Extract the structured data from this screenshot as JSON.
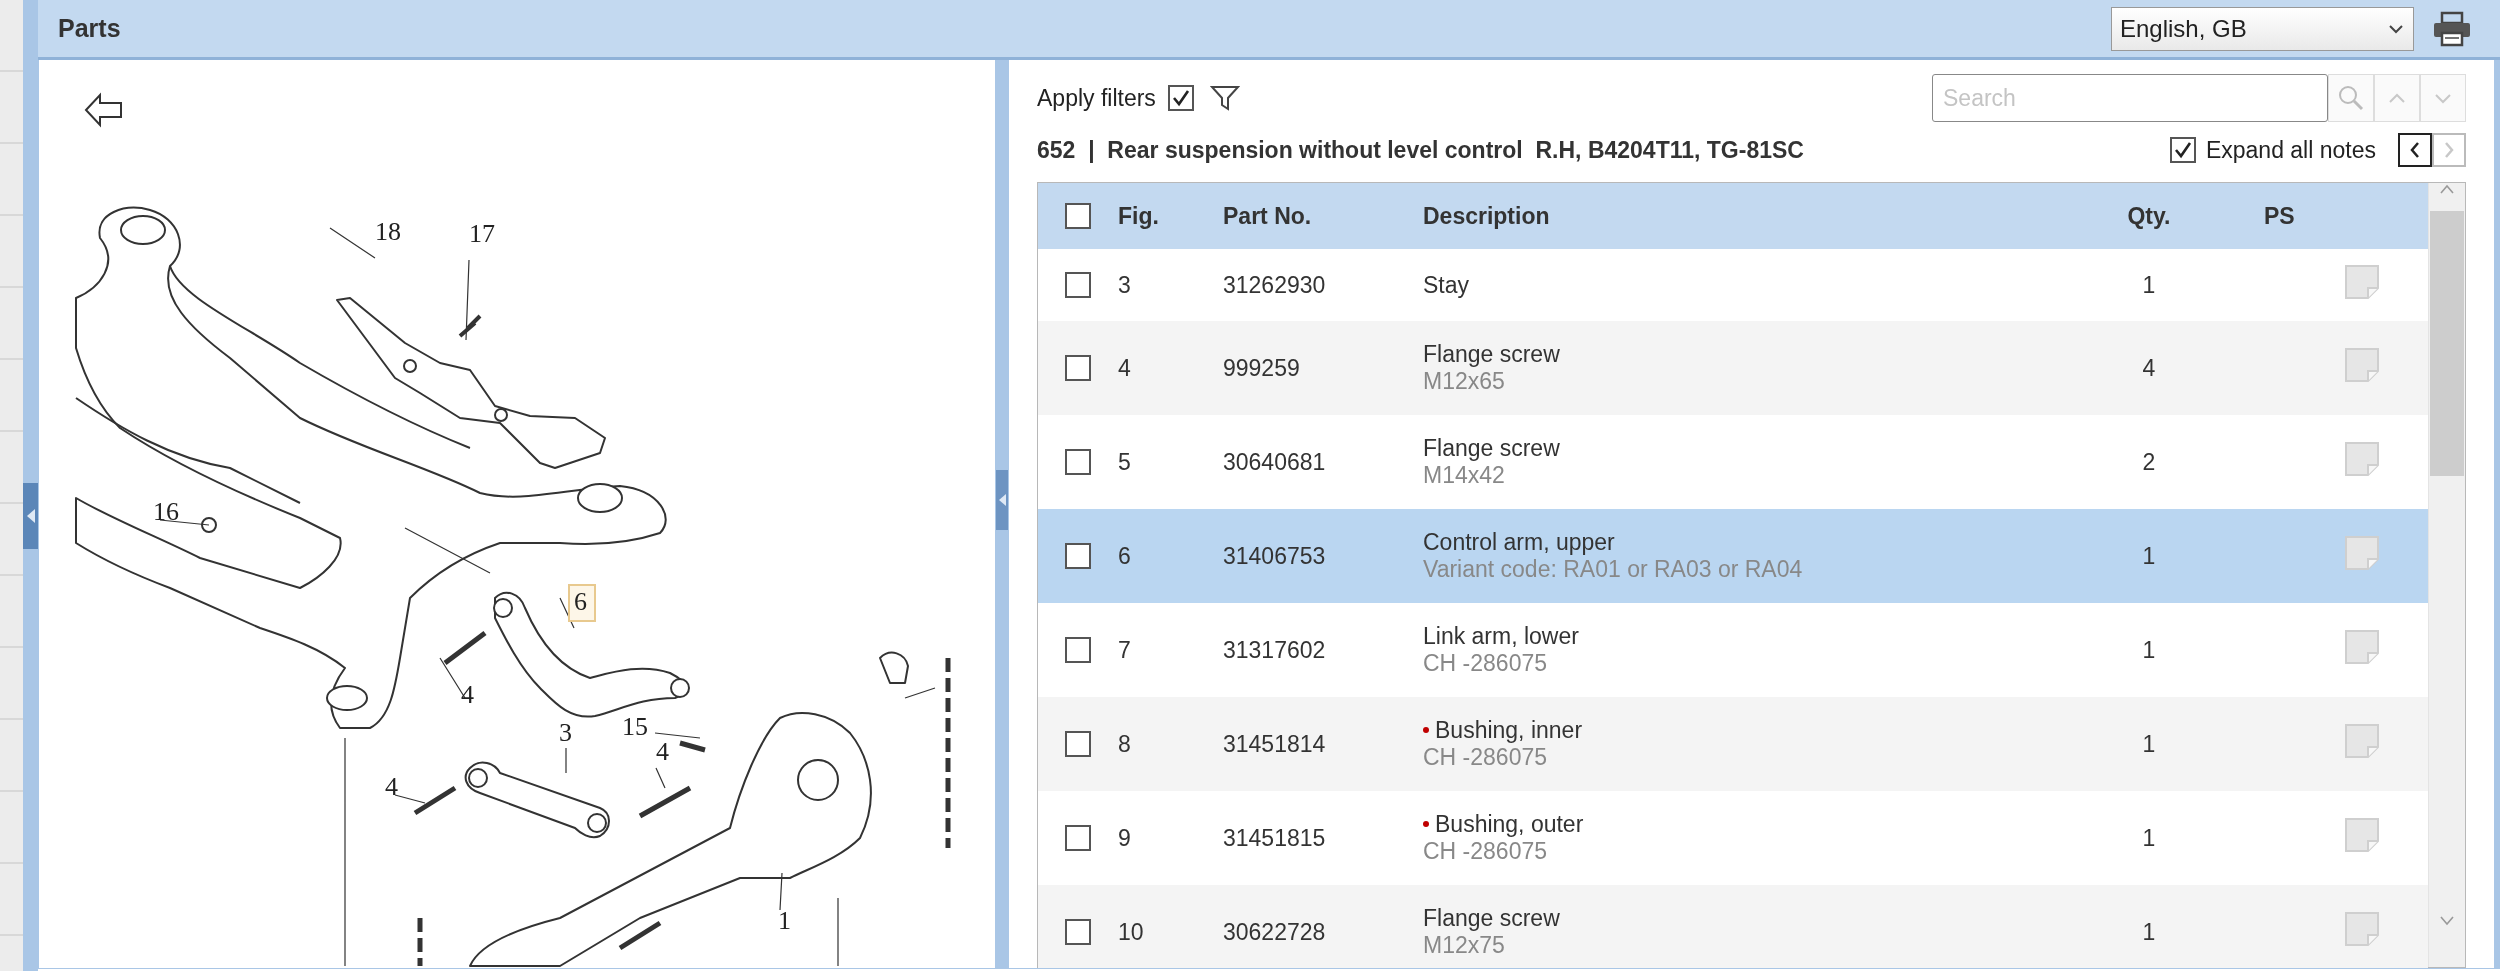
{
  "header": {
    "title": "Parts",
    "language": "English, GB"
  },
  "diagram": {
    "callouts": [
      {
        "label": "18",
        "selected": false
      },
      {
        "label": "17",
        "selected": false
      },
      {
        "label": "16",
        "selected": false
      },
      {
        "label": "6",
        "selected": true
      },
      {
        "label": "4",
        "selected": false
      },
      {
        "label": "3",
        "selected": false
      },
      {
        "label": "15",
        "selected": false
      },
      {
        "label": "4",
        "selected": false
      },
      {
        "label": "4",
        "selected": false
      },
      {
        "label": "1",
        "selected": false
      }
    ]
  },
  "filters": {
    "label": "Apply filters",
    "checked": true
  },
  "search": {
    "placeholder": "Search",
    "nav_buttons": [
      {
        "kind": "up",
        "disabled": true
      },
      {
        "kind": "down",
        "disabled": true
      }
    ]
  },
  "group_title": "652  |  Rear suspension without level control  R.H, B4204T11, TG-81SC",
  "expand_notes": {
    "label": "Expand all notes",
    "checked": true
  },
  "pager": [
    {
      "kind": "previous",
      "disabled": false
    },
    {
      "kind": "next",
      "disabled": true
    }
  ],
  "table": {
    "columns": [
      "Fig.",
      "Part No.",
      "Description",
      "Qty.",
      "PS"
    ],
    "all_checked": false,
    "rows": [
      {
        "fig": "3",
        "part_no": "31262930",
        "description": "Stay",
        "note": "",
        "qty": "1",
        "checked": false,
        "selected": false,
        "flagged": false
      },
      {
        "fig": "4",
        "part_no": "999259",
        "description": "Flange screw",
        "note": "M12x65",
        "qty": "4",
        "checked": false,
        "selected": false,
        "flagged": false
      },
      {
        "fig": "5",
        "part_no": "30640681",
        "description": "Flange screw",
        "note": "M14x42",
        "qty": "2",
        "checked": false,
        "selected": false,
        "flagged": false
      },
      {
        "fig": "6",
        "part_no": "31406753",
        "description": "Control arm, upper",
        "note": "Variant code: RA01 or RA03 or RA04",
        "qty": "1",
        "checked": false,
        "selected": true,
        "flagged": false
      },
      {
        "fig": "7",
        "part_no": "31317602",
        "description": "Link arm, lower",
        "note": "CH -286075",
        "qty": "1",
        "checked": false,
        "selected": false,
        "flagged": false
      },
      {
        "fig": "8",
        "part_no": "31451814",
        "description": "Bushing, inner",
        "note": "CH -286075",
        "qty": "1",
        "checked": false,
        "selected": false,
        "flagged": true
      },
      {
        "fig": "9",
        "part_no": "31451815",
        "description": "Bushing, outer",
        "note": "CH -286075",
        "qty": "1",
        "checked": false,
        "selected": false,
        "flagged": true
      },
      {
        "fig": "10",
        "part_no": "30622728",
        "description": "Flange screw",
        "note": "M12x75",
        "qty": "1",
        "checked": false,
        "selected": false,
        "flagged": false
      }
    ]
  }
}
